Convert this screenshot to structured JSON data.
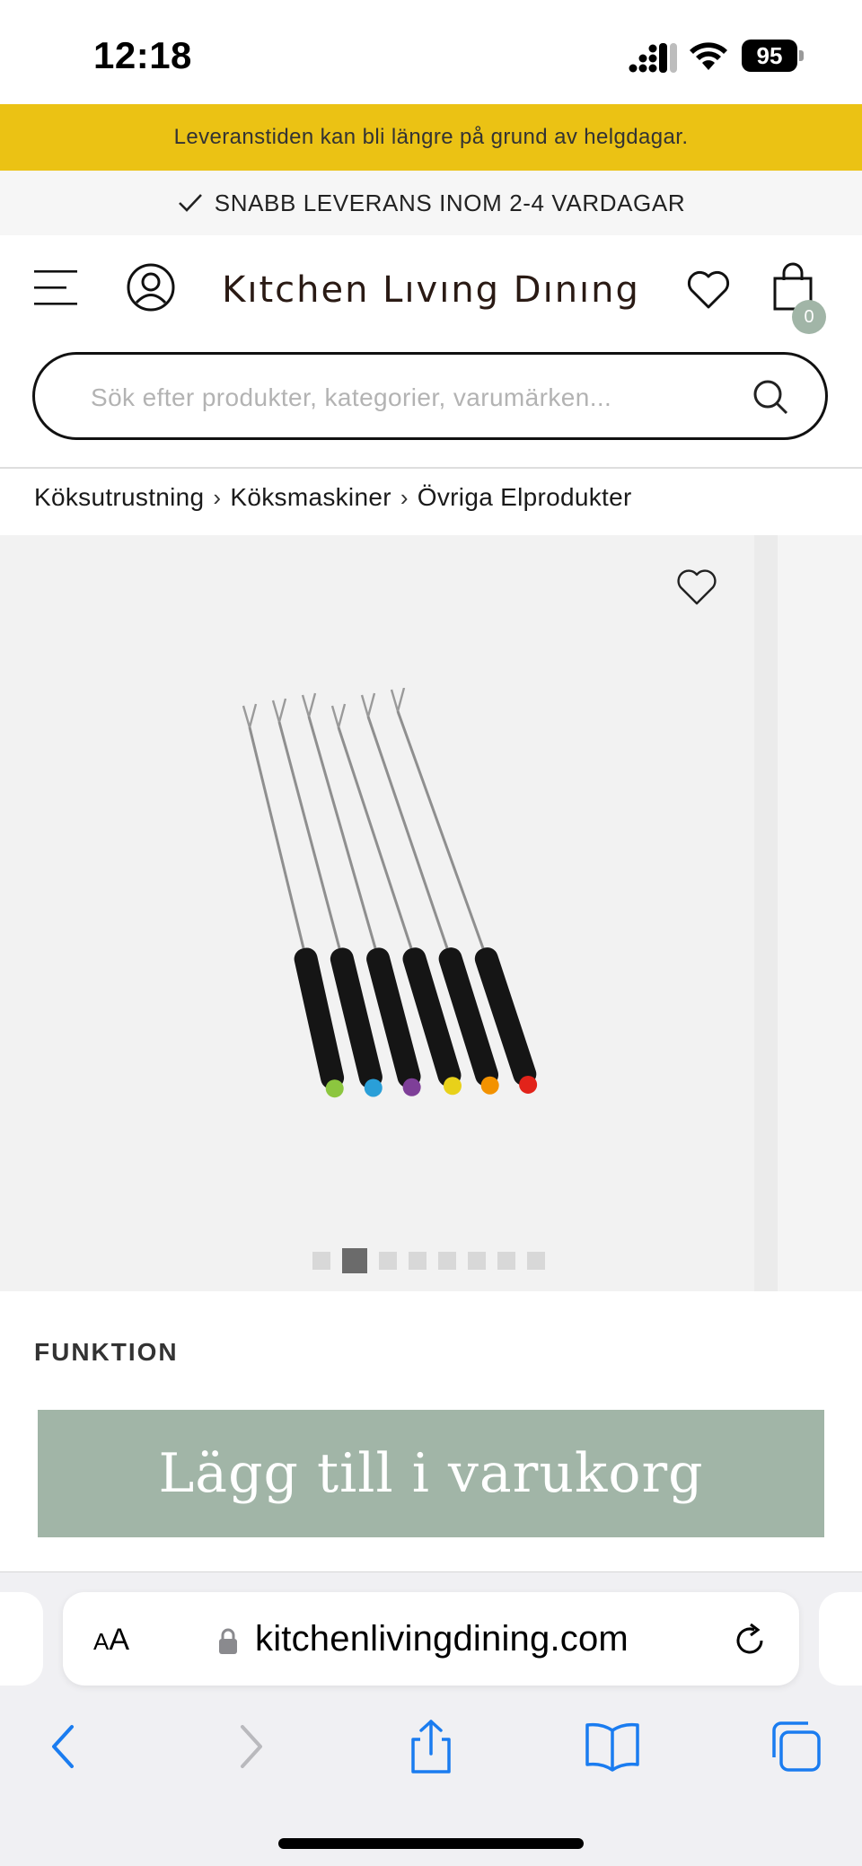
{
  "status_bar": {
    "time": "12:18",
    "battery": "95"
  },
  "notice_banner": {
    "text": "Leveranstiden kan bli längre på grund av helgdagar."
  },
  "delivery_banner": {
    "text": "SNABB LEVERANS INOM 2-4 VARDAGAR"
  },
  "header": {
    "logo": "Kıtchen Lıvıng Dınıng",
    "cart_count": "0"
  },
  "search": {
    "placeholder": "Sök efter produkter, kategorier, varumärken..."
  },
  "breadcrumb": {
    "items": [
      "Köksutrustning",
      "Köksmaskiner",
      "Övriga Elprodukter"
    ],
    "separator": "›"
  },
  "gallery": {
    "image_count": 8,
    "active_index": 1,
    "handle_tip_colors": [
      "#8cc63f",
      "#2a9fd8",
      "#7e3f98",
      "#e8d11a",
      "#f39200",
      "#e2231a"
    ]
  },
  "product": {
    "section_label": "FUNKTION",
    "add_to_cart_label": "Lägg till i varukorg"
  },
  "browser": {
    "text_size_label": "AA",
    "url": "kitchenlivingdining.com"
  },
  "colors": {
    "notice_banner_bg": "#ebc214",
    "accent_sage": "#a1b5a7",
    "ios_blue": "#1a7cf0"
  }
}
